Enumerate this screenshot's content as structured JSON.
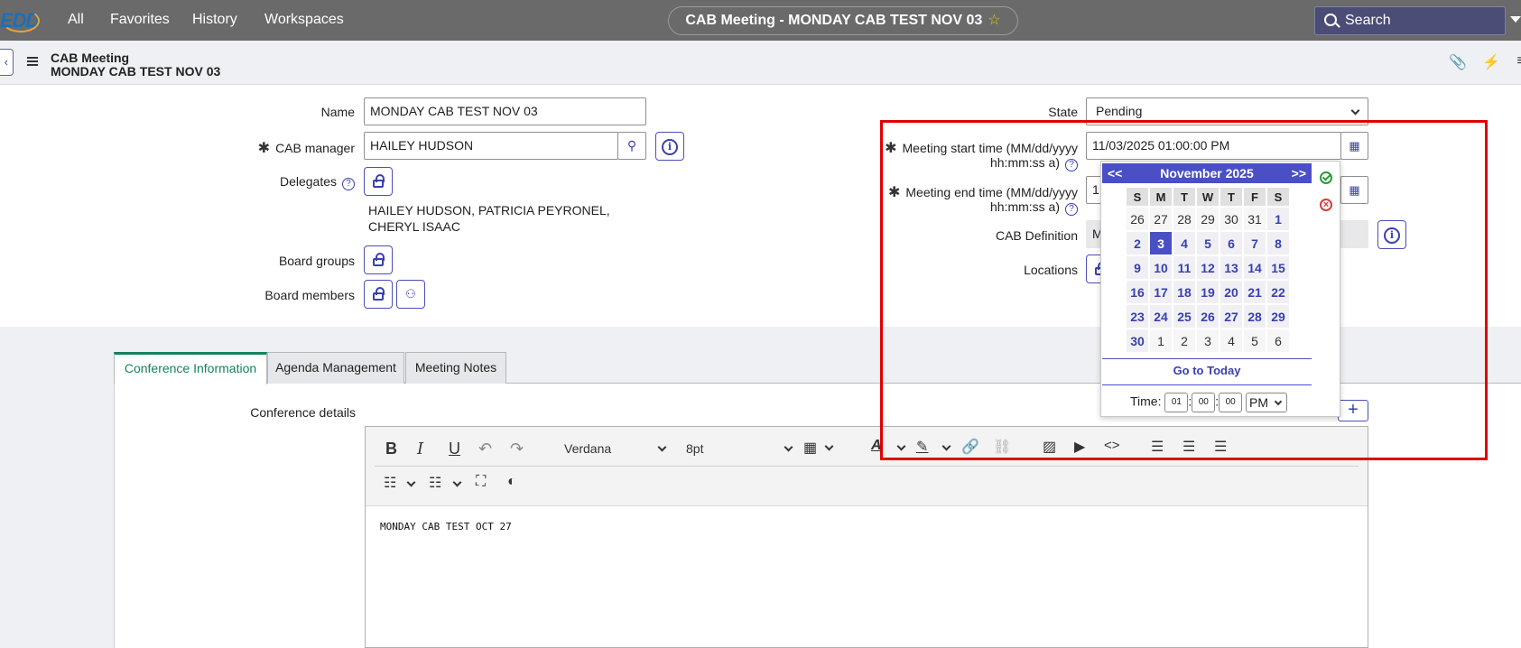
{
  "nav": {
    "logo_text": "EDD",
    "links": [
      "All",
      "Favorites",
      "History",
      "Workspaces"
    ],
    "record_title": "CAB Meeting - MONDAY CAB TEST NOV 03",
    "search_label": "Search"
  },
  "header": {
    "record_type": "CAB Meeting",
    "record_name": "MONDAY CAB TEST NOV 03"
  },
  "form": {
    "name_label": "Name",
    "name_value": "MONDAY CAB TEST NOV 03",
    "cab_manager_label": "CAB manager",
    "cab_manager_value": "HAILEY HUDSON",
    "delegates_label": "Delegates",
    "delegates_line1": "HAILEY HUDSON, PATRICIA PEYRONEL,",
    "delegates_line2": "CHERYL ISAAC",
    "board_groups_label": "Board groups",
    "board_members_label": "Board members",
    "state_label": "State",
    "state_value": "Pending",
    "start_label_1": "Meeting start time (MM/dd/yyyy",
    "start_label_2": "hh:mm:ss a)",
    "start_value": "11/03/2025 01:00:00 PM",
    "end_label_1": "Meeting end time (MM/dd/yyyy",
    "end_label_2": "hh:mm:ss a)",
    "end_value_partial": "1",
    "cab_definition_label": "CAB Definition",
    "cab_definition_partial": "M",
    "locations_label": "Locations"
  },
  "tabs": [
    "Conference Information",
    "Agenda Management",
    "Meeting Notes"
  ],
  "conference": {
    "details_label": "Conference details",
    "font_family": "Verdana",
    "font_size": "8pt",
    "content": "MONDAY CAB TEST OCT 27"
  },
  "calendar": {
    "prev": "<<",
    "next": ">>",
    "month_label": "November 2025",
    "weekdays": [
      "S",
      "M",
      "T",
      "W",
      "T",
      "F",
      "S"
    ],
    "weeks": [
      [
        "26",
        "27",
        "28",
        "29",
        "30",
        "31",
        "1"
      ],
      [
        "2",
        "3",
        "4",
        "5",
        "6",
        "7",
        "8"
      ],
      [
        "9",
        "10",
        "11",
        "12",
        "13",
        "14",
        "15"
      ],
      [
        "16",
        "17",
        "18",
        "19",
        "20",
        "21",
        "22"
      ],
      [
        "23",
        "24",
        "25",
        "26",
        "27",
        "28",
        "29"
      ],
      [
        "30",
        "1",
        "2",
        "3",
        "4",
        "5",
        "6"
      ]
    ],
    "selected_day": "3",
    "goto_today": "Go to Today",
    "time_label": "Time:",
    "hour": "01",
    "minute": "00",
    "second": "00",
    "ampm": "PM"
  },
  "colors": {
    "accent": "#4b4fc4",
    "tab_active": "#12845c",
    "annotation_box": "#e00000"
  }
}
